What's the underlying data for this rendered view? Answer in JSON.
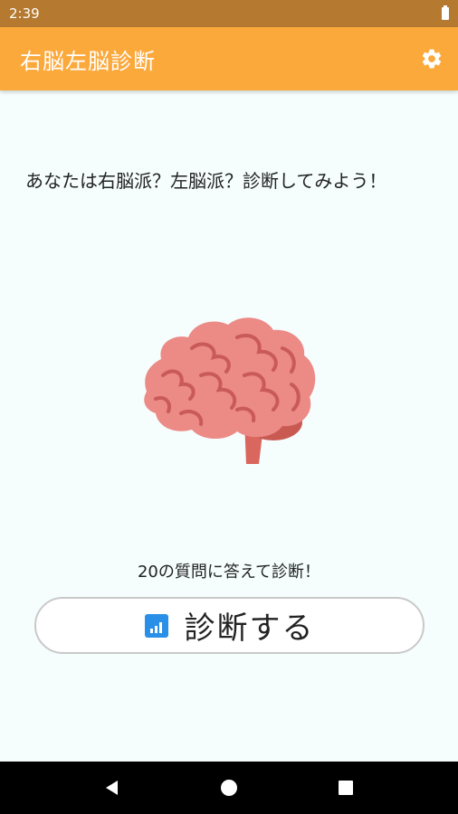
{
  "status_bar": {
    "time": "2:39"
  },
  "app_bar": {
    "title": "右脳左脳診断",
    "settings_icon": "gear-icon"
  },
  "main": {
    "intro_text": "あなたは右脳派？左脳派？診断してみよう！",
    "illustration": "brain-icon",
    "prompt_text": "20の質問に答えて診断！",
    "diagnose_button": {
      "label": "診断する",
      "icon": "bar-chart-icon",
      "icon_color": "#2a8fe6"
    }
  },
  "colors": {
    "status_bar": "#b5792f",
    "app_bar": "#fca93c",
    "background": "#f5fdfd"
  },
  "nav_bar": {
    "back_icon": "back-triangle-icon",
    "home_icon": "home-circle-icon",
    "recents_icon": "recents-square-icon"
  }
}
